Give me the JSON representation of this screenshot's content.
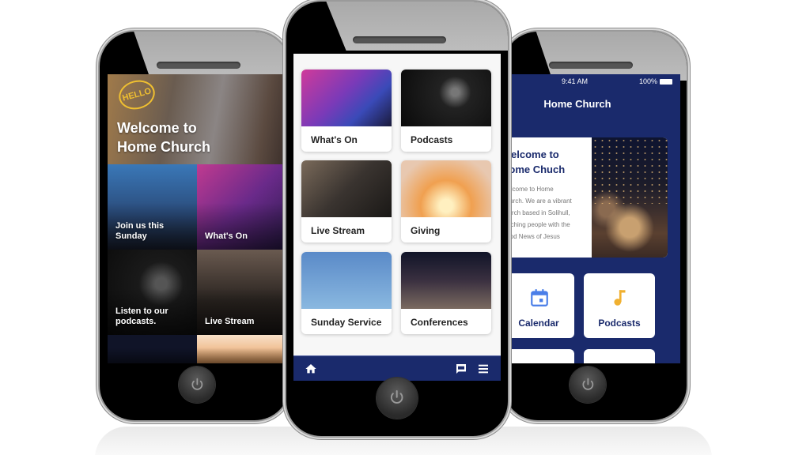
{
  "left_phone": {
    "hero": {
      "badge": "HELLO",
      "title_line1": "Welcome to",
      "title_line2": "Home Church"
    },
    "tiles": [
      {
        "label_line1": "Join us this",
        "label_line2": "Sunday"
      },
      {
        "label_line1": "What's On",
        "label_line2": ""
      },
      {
        "label_line1": "Listen to our",
        "label_line2": "podcasts."
      },
      {
        "label_line1": "Live Stream",
        "label_line2": ""
      }
    ]
  },
  "middle_phone": {
    "cards": [
      {
        "label": "What's On"
      },
      {
        "label": "Podcasts"
      },
      {
        "label": "Live Stream"
      },
      {
        "label": "Giving"
      },
      {
        "label": "Sunday Service"
      },
      {
        "label": "Conferences"
      }
    ],
    "bottom_nav": {
      "home": "home-icon",
      "chat": "chat-icon",
      "menu": "menu-icon"
    }
  },
  "right_phone": {
    "status": {
      "time": "9:41 AM",
      "battery": "100%"
    },
    "title": "Home Church",
    "welcome": {
      "heading_line1": "Welcome to",
      "heading_line2": "Home Chuch",
      "body_lines": [
        "Welcome to Home",
        "Church. We are a vibrant",
        "church based in Solihull,",
        "reaching people with the",
        "Good News of Jesus"
      ]
    },
    "icon_cards": [
      {
        "label": "Calendar",
        "icon": "calendar-icon",
        "color": "#4a7ee8"
      },
      {
        "label": "Podcasts",
        "icon": "music-note-icon",
        "color": "#f0b030"
      }
    ]
  },
  "colors": {
    "brand_navy": "#1a2a6c"
  }
}
